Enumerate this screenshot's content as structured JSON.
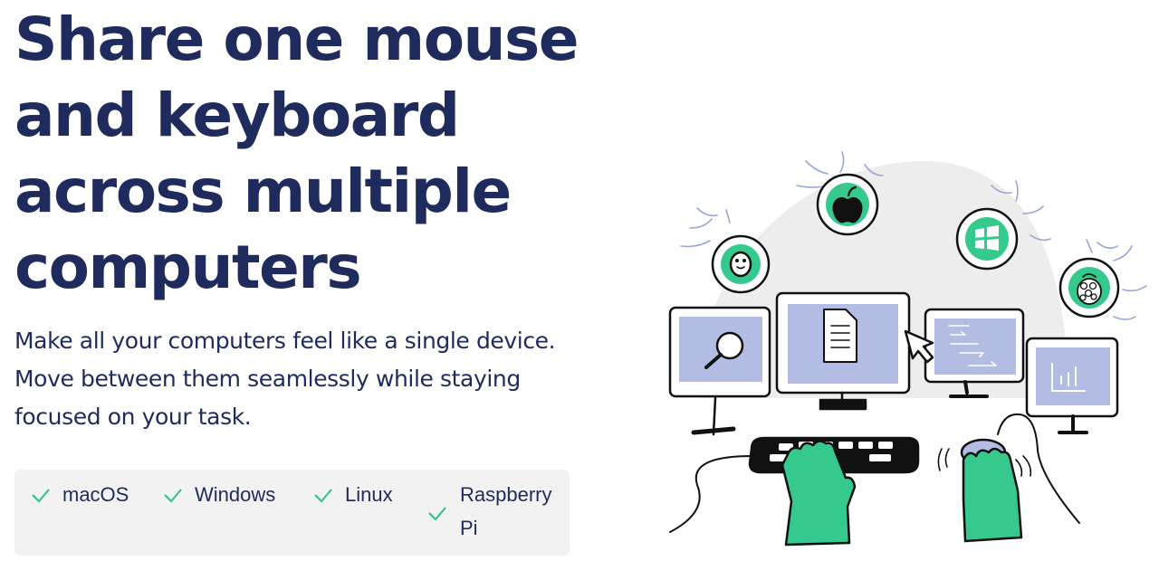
{
  "hero": {
    "title_lines": [
      "Share one mouse",
      "and keyboard",
      "across multiple",
      "computers"
    ],
    "subtitle_lines": [
      "Make all your computers feel like a single device.",
      "Move between them seamlessly while staying",
      "focused on your task."
    ]
  },
  "platforms": {
    "items": [
      {
        "label": "macOS",
        "icon": "check-icon"
      },
      {
        "label": "Windows",
        "icon": "check-icon"
      },
      {
        "label": "Linux",
        "icon": "check-icon"
      },
      {
        "label_line1": "Raspberry",
        "label_line2": "Pi",
        "icon": "check-icon"
      }
    ],
    "check_color": "#2fbf8a"
  },
  "illustration": {
    "icons": [
      "penguin-icon",
      "apple-icon",
      "windows-icon",
      "raspberry-icon",
      "magnifier-icon",
      "document-icon",
      "code-icon",
      "bar-chart-icon",
      "cursor-icon"
    ],
    "accent_green": "#35c98e",
    "screen_blue": "#b3bde3",
    "outline": "#111111"
  }
}
